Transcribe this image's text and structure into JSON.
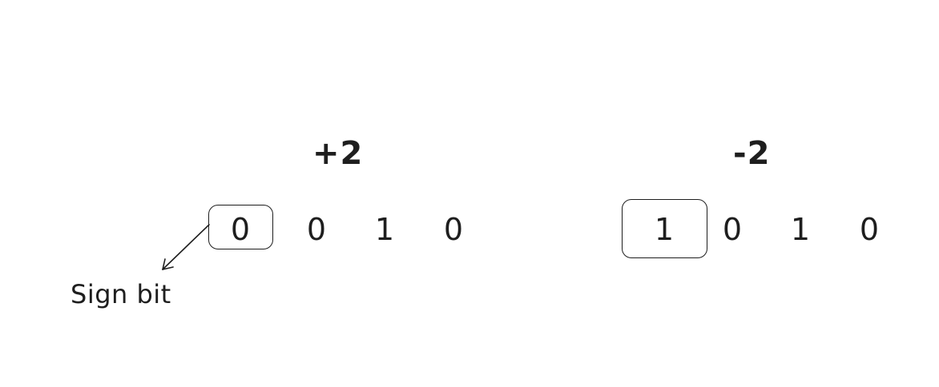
{
  "positive": {
    "label": "+2",
    "bits": [
      "0",
      "0",
      "1",
      "0"
    ]
  },
  "negative": {
    "label": "-2",
    "bits": [
      "1",
      "0",
      "1",
      "0"
    ]
  },
  "annotation": {
    "text": "Sign bit"
  }
}
